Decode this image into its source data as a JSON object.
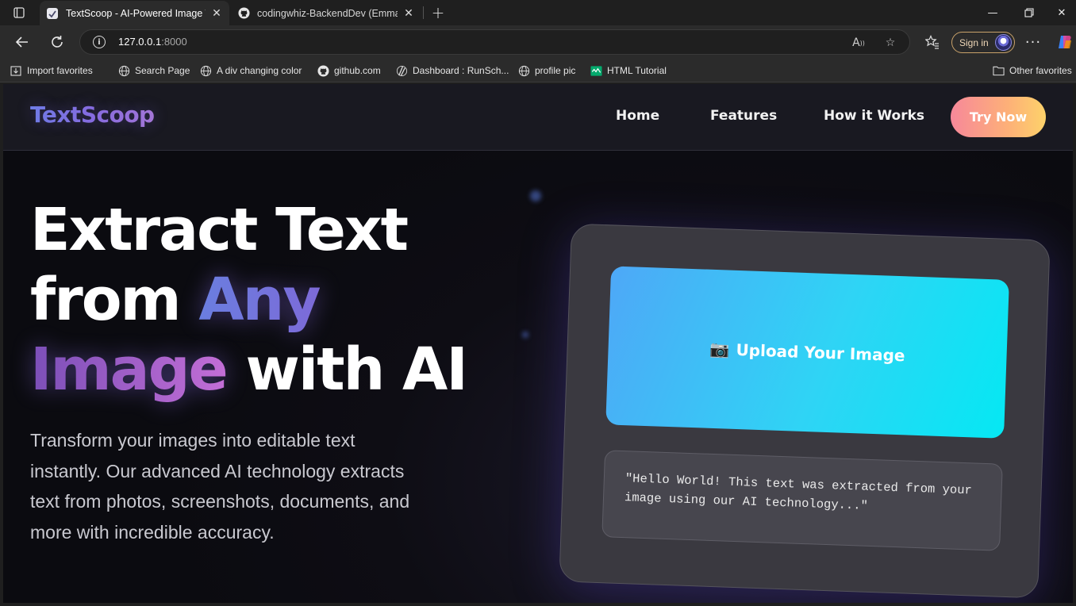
{
  "browser": {
    "tabs": [
      {
        "title": "TextScoop - AI-Powered Image Te",
        "active": true,
        "icon": "textscoop-favicon"
      },
      {
        "title": "codingwhiz-BackendDev (Emman",
        "active": false,
        "icon": "github-icon"
      }
    ],
    "address": {
      "host": "127.0.0.1",
      "port": ":8000"
    },
    "signin_label": "Sign in",
    "bookmarks": [
      {
        "label": "Import favorites",
        "icon": "import-icon"
      },
      {
        "label": "Search Page",
        "icon": "globe-icon"
      },
      {
        "label": "A div changing color",
        "icon": "globe-icon"
      },
      {
        "label": "github.com",
        "icon": "github-icon"
      },
      {
        "label": "Dashboard : RunSch...",
        "icon": "runschool-icon"
      },
      {
        "label": "profile pic",
        "icon": "globe-icon"
      },
      {
        "label": "HTML Tutorial",
        "icon": "w3-icon"
      }
    ],
    "other_favorites": "Other favorites"
  },
  "site": {
    "logo": "TextScoop",
    "nav": [
      "Home",
      "Features",
      "How it Works"
    ],
    "cta": "Try Now",
    "hero": {
      "line1": "Extract Text",
      "line2_plain": "from ",
      "line2_accent": "Any",
      "line3_accent": "Image",
      "line3_plain": " with AI",
      "description": "Transform your images into editable text instantly. Our advanced AI technology extracts text from photos, screenshots, documents, and more with incredible accuracy."
    },
    "demo": {
      "upload_label": "Upload Your Image",
      "camera_glyph": "📷",
      "sample_output": "\"Hello World! This text was extracted from your image using our AI technology...\""
    }
  },
  "colors": {
    "cta_gradient": [
      "#f7889a",
      "#fdd26a"
    ],
    "upload_gradient": [
      "#4ea8f7",
      "#05e8f3"
    ],
    "accent_purple": "#8a6fe0"
  }
}
